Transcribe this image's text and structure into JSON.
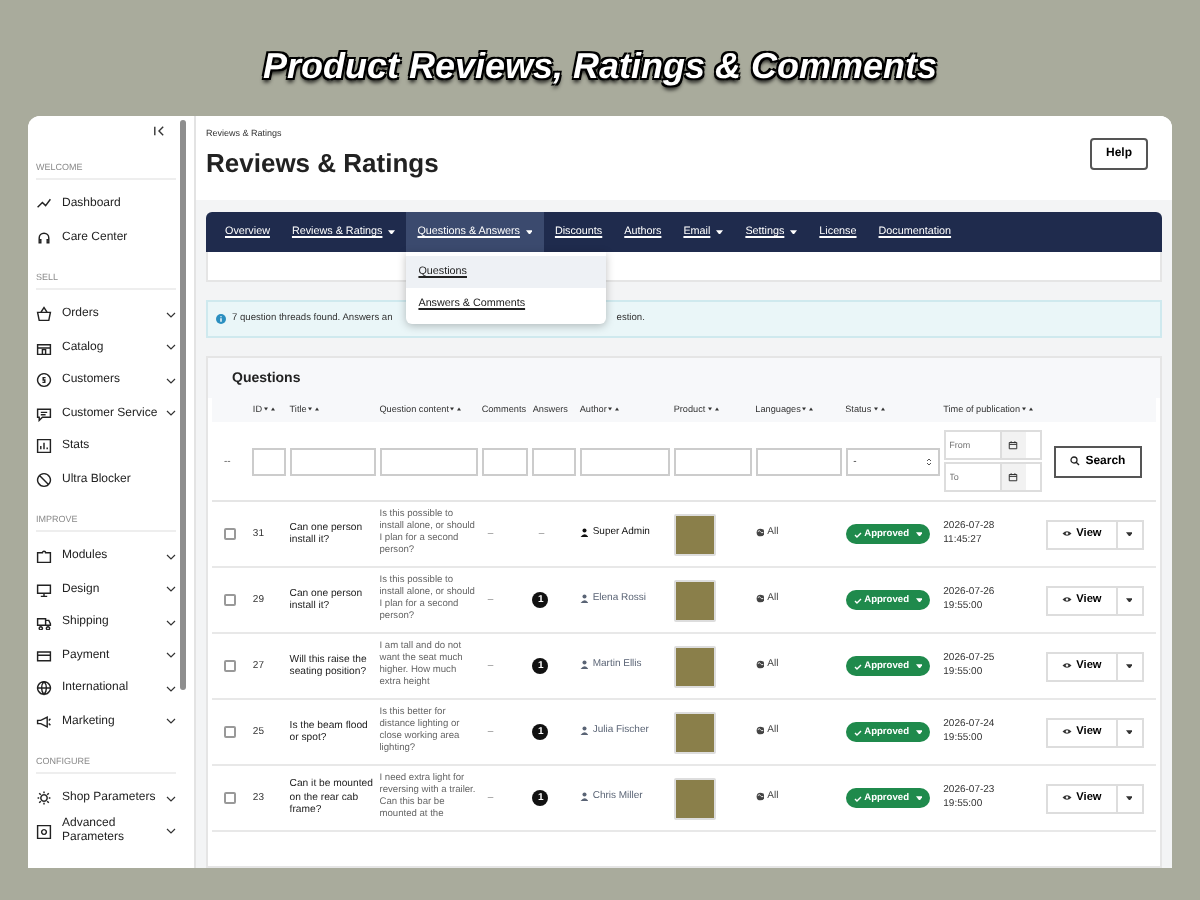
{
  "banner": {
    "title": "Product Reviews, Ratings & Comments"
  },
  "sidebar": {
    "sections": [
      {
        "label": "WELCOME",
        "items": [
          {
            "label": "Dashboard",
            "has_submenu": false
          },
          {
            "label": "Care Center",
            "has_submenu": false
          }
        ]
      },
      {
        "label": "SELL",
        "items": [
          {
            "label": "Orders",
            "has_submenu": true
          },
          {
            "label": "Catalog",
            "has_submenu": true
          },
          {
            "label": "Customers",
            "has_submenu": true
          },
          {
            "label": "Customer Service",
            "has_submenu": true
          },
          {
            "label": "Stats",
            "has_submenu": false
          },
          {
            "label": "Ultra Blocker",
            "has_submenu": false
          }
        ]
      },
      {
        "label": "IMPROVE",
        "items": [
          {
            "label": "Modules",
            "has_submenu": true
          },
          {
            "label": "Design",
            "has_submenu": true
          },
          {
            "label": "Shipping",
            "has_submenu": true
          },
          {
            "label": "Payment",
            "has_submenu": true
          },
          {
            "label": "International",
            "has_submenu": true
          },
          {
            "label": "Marketing",
            "has_submenu": true
          }
        ]
      },
      {
        "label": "CONFIGURE",
        "items": [
          {
            "label": "Shop Parameters",
            "has_submenu": true
          },
          {
            "label": "Advanced Parameters",
            "has_submenu": true
          }
        ]
      }
    ]
  },
  "breadcrumb": "Reviews & Ratings",
  "page_title": "Reviews & Ratings",
  "help_button": "Help",
  "nav": [
    {
      "label": "Overview",
      "dropdown": false,
      "selected": false
    },
    {
      "label": "Reviews & Ratings",
      "dropdown": true,
      "selected": false
    },
    {
      "label": "Questions & Answers",
      "dropdown": true,
      "selected": true
    },
    {
      "label": "Discounts",
      "dropdown": false,
      "selected": false
    },
    {
      "label": "Authors",
      "dropdown": false,
      "selected": false
    },
    {
      "label": "Email",
      "dropdown": true,
      "selected": false
    },
    {
      "label": "Settings",
      "dropdown": true,
      "selected": false
    },
    {
      "label": "License",
      "dropdown": false,
      "selected": false
    },
    {
      "label": "Documentation",
      "dropdown": false,
      "selected": false
    }
  ],
  "dropdown_menu": [
    {
      "label": "Questions",
      "selected": true
    },
    {
      "label": "Answers & Comments",
      "selected": false
    }
  ],
  "info": {
    "text_before": "7 question threads found. Answers an",
    "text_after": "estion."
  },
  "table": {
    "title": "Questions",
    "columns": [
      {
        "label": "ID",
        "sortable": true
      },
      {
        "label": "Title",
        "sortable": true
      },
      {
        "label": "Question content",
        "sortable": true
      },
      {
        "label": "Comments",
        "sortable": false
      },
      {
        "label": "Answers",
        "sortable": false
      },
      {
        "label": "Author",
        "sortable": true
      },
      {
        "label": "Product",
        "sortable": true
      },
      {
        "label": "Languages",
        "sortable": true
      },
      {
        "label": "Status",
        "sortable": true
      },
      {
        "label": "Time of publication",
        "sortable": true
      }
    ],
    "filters": {
      "bulk": "--",
      "status_value": "-",
      "date_from_placeholder": "From",
      "date_to_placeholder": "To",
      "search_button": "Search"
    },
    "rows": [
      {
        "selected": false,
        "id": "31",
        "title": "Can one person install it?",
        "content": "Is this possible to install alone, or should I plan for a second person?",
        "comments": "–",
        "answers": "–",
        "answers_badge": false,
        "author": "Super Admin",
        "author_is_admin": true,
        "languages": "All",
        "status": "Approved",
        "date": "2026-07-28",
        "time": "11:45:27",
        "view": "View"
      },
      {
        "selected": false,
        "id": "29",
        "title": "Can one person install it?",
        "content": "Is this possible to install alone, or should I plan for a second person?",
        "comments": "–",
        "answers": "1",
        "answers_badge": true,
        "author": "Elena Rossi",
        "author_is_admin": false,
        "languages": "All",
        "status": "Approved",
        "date": "2026-07-26",
        "time": "19:55:00",
        "view": "View"
      },
      {
        "selected": false,
        "id": "27",
        "title": "Will this raise the seating position?",
        "content": "I am tall and do not want the seat much higher. How much extra height",
        "comments": "–",
        "answers": "1",
        "answers_badge": true,
        "author": "Martin Ellis",
        "author_is_admin": false,
        "languages": "All",
        "status": "Approved",
        "date": "2026-07-25",
        "time": "19:55:00",
        "view": "View"
      },
      {
        "selected": false,
        "id": "25",
        "title": "Is the beam flood or spot?",
        "content": "Is this better for distance lighting or close working area lighting?",
        "comments": "–",
        "answers": "1",
        "answers_badge": true,
        "author": "Julia Fischer",
        "author_is_admin": false,
        "languages": "All",
        "status": "Approved",
        "date": "2026-07-24",
        "time": "19:55:00",
        "view": "View"
      },
      {
        "selected": false,
        "id": "23",
        "title": "Can it be mounted on the rear cab frame?",
        "content": "I need extra light for reversing with a trailer. Can this bar be mounted at the",
        "comments": "–",
        "answers": "1",
        "answers_badge": true,
        "author": "Chris Miller",
        "author_is_admin": false,
        "languages": "All",
        "status": "Approved",
        "date": "2026-07-23",
        "time": "19:55:00",
        "view": "View"
      }
    ]
  }
}
